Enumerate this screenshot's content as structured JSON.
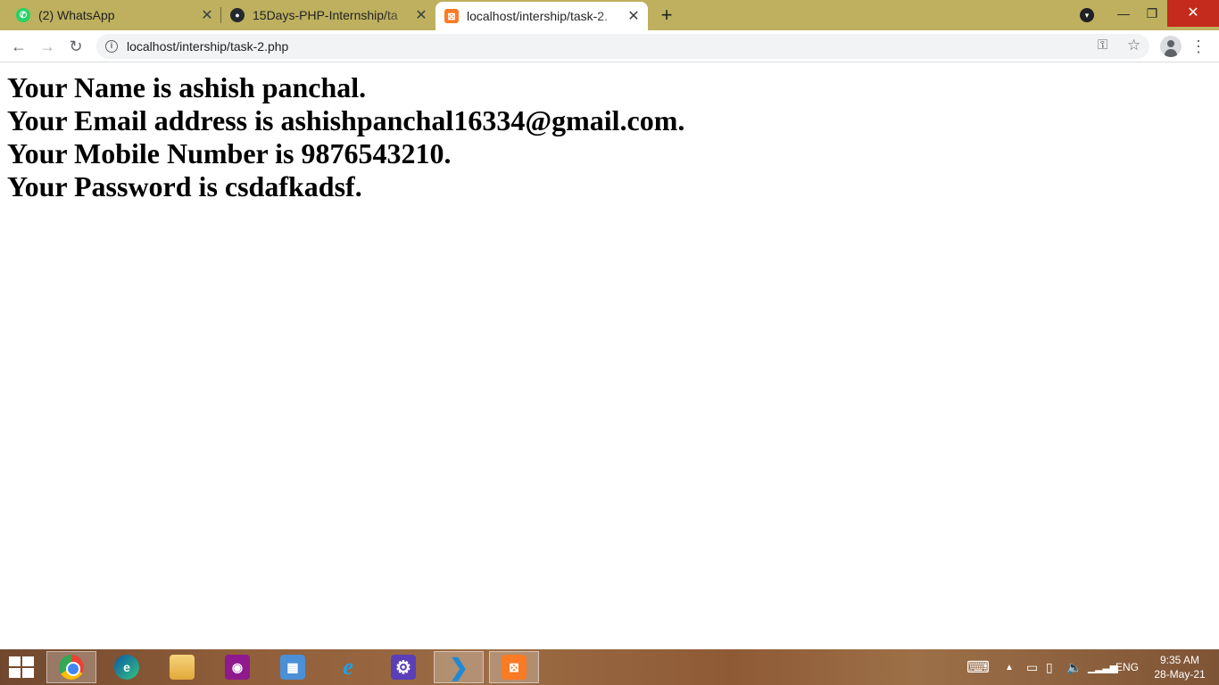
{
  "browser": {
    "tabs": [
      {
        "title": "(2) WhatsApp",
        "favicon": "whatsapp-icon",
        "active": false
      },
      {
        "title": "15Days-PHP-Internship/ta",
        "favicon": "github-icon",
        "active": false
      },
      {
        "title": "localhost/intership/task-2.",
        "favicon": "xampp-icon",
        "active": true
      }
    ],
    "new_tab": "+",
    "url": "localhost/intership/task-2.php",
    "colors": {
      "tabstrip": "#beb05e",
      "close_button": "#c42b1c"
    }
  },
  "page": {
    "lines": [
      "Your Name is ashish panchal.",
      "Your Email address is ashishpanchal16334@gmail.com.",
      "Your Mobile Number is 9876543210.",
      "Your Password is csdafkadsf."
    ]
  },
  "taskbar": {
    "apps": [
      "chrome",
      "edge",
      "file-explorer",
      "camera",
      "control-panel",
      "internet-explorer",
      "settings",
      "vscode",
      "xampp"
    ],
    "language": "ENG",
    "time": "9:35 AM",
    "date": "28-May-21"
  }
}
